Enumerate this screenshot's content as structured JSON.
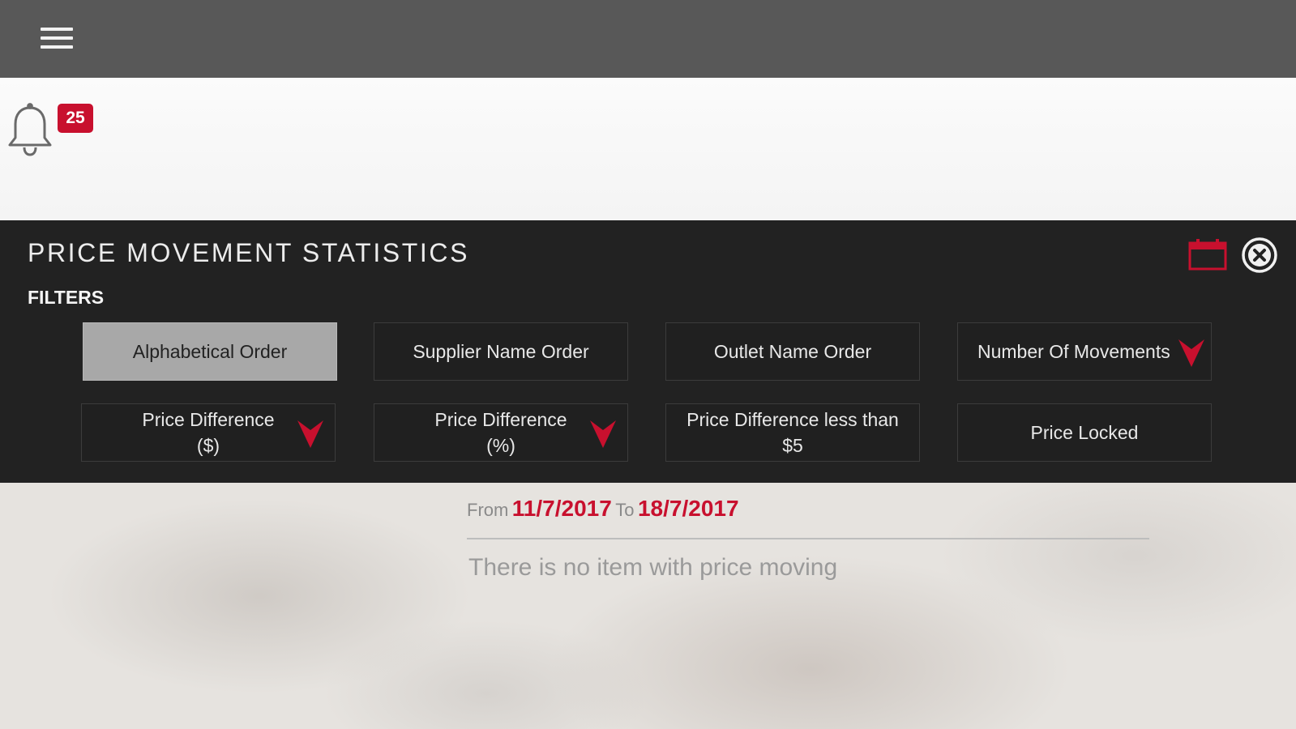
{
  "topbar": {
    "menu_icon": "hamburger-menu-icon"
  },
  "notifications": {
    "icon": "bell-icon",
    "count": "25"
  },
  "panel": {
    "title": "PRICE MOVEMENT STATISTICS",
    "filters_label": "FILTERS",
    "calendar_icon": "calendar-icon",
    "close_icon": "close-circle-icon"
  },
  "filters": [
    {
      "label": "Alphabetical Order",
      "active": true,
      "sort_arrow": false
    },
    {
      "label": "Supplier Name Order",
      "active": false,
      "sort_arrow": false
    },
    {
      "label": "Outlet Name Order",
      "active": false,
      "sort_arrow": false
    },
    {
      "label": "Number Of Movements",
      "active": false,
      "sort_arrow": true
    },
    {
      "label": "Price Difference\n($)",
      "active": false,
      "sort_arrow": true
    },
    {
      "label": "Price Difference\n(%)",
      "active": false,
      "sort_arrow": true
    },
    {
      "label": "Price Difference less than\n$5",
      "active": false,
      "sort_arrow": false
    },
    {
      "label": "Price Locked",
      "active": false,
      "sort_arrow": false
    }
  ],
  "date_range": {
    "from_label": "From",
    "from_date": "11/7/2017",
    "to_label": "To",
    "to_date": "18/7/2017"
  },
  "empty_message": "There is no item with price moving",
  "colors": {
    "accent": "#c8102e",
    "topbar": "#585858",
    "panel": "#222222",
    "active_filter": "#a8a8a8"
  }
}
